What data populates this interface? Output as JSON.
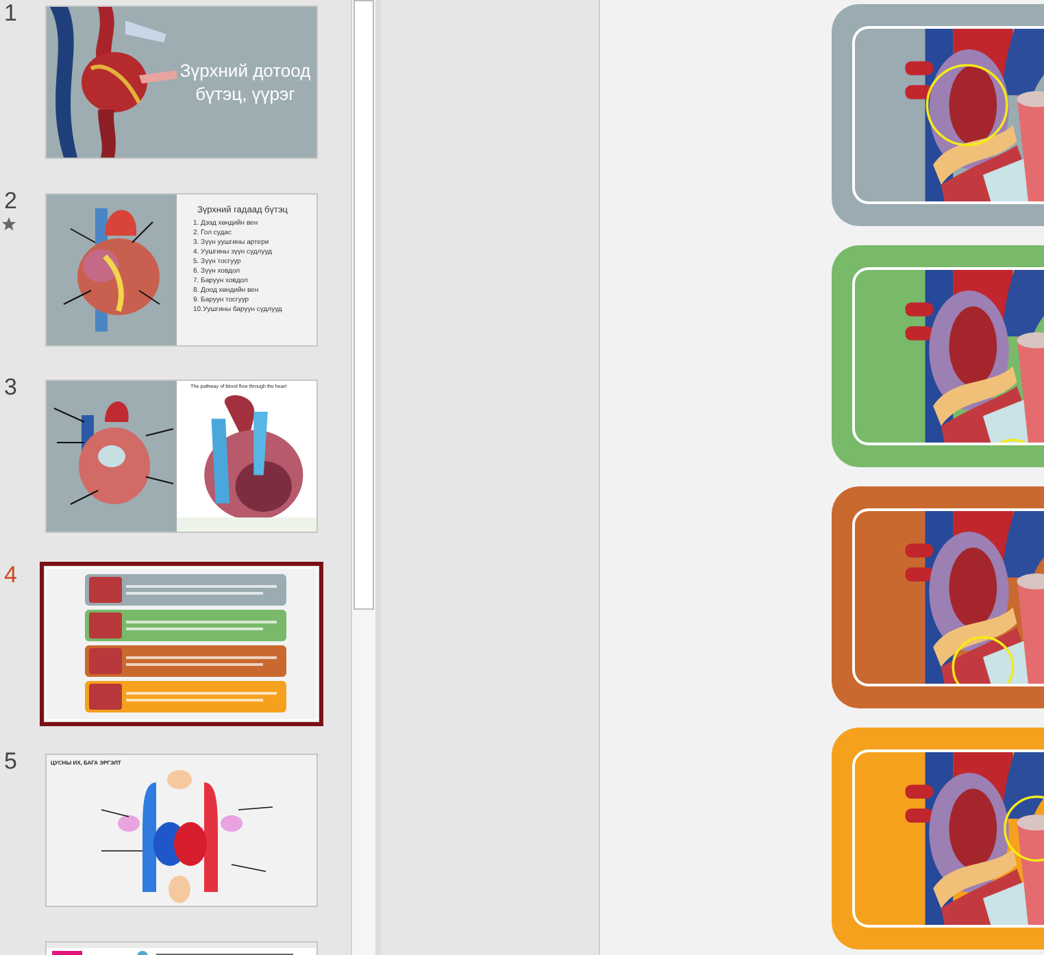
{
  "slides_panel": {
    "slides": [
      {
        "number": "1",
        "selected": false,
        "animated": false,
        "kind": "title",
        "title": "Зүрхний дотоод бүтэц, үүрэг"
      },
      {
        "number": "2",
        "selected": false,
        "animated": true,
        "kind": "list",
        "title": "Зүрхний гадаад бүтэц",
        "items": [
          "1. Дээд хөндийн вен",
          "2. Гол судас",
          "3. Зүүн уушгины артери",
          "4. Уушгины зүүн судлууд",
          "5. Зүүн тосгуур",
          "6. Зүүн ховдол",
          "7. Баруун ховдол",
          "8. Доод хөндийн вен",
          "9. Баруун тосгуур",
          "10.Уушгины баруун судлууд"
        ]
      },
      {
        "number": "3",
        "selected": false,
        "animated": false,
        "kind": "diagram",
        "title": "The pathway of blood flow through the heart"
      },
      {
        "number": "4",
        "selected": true,
        "animated": false,
        "kind": "cards"
      },
      {
        "number": "5",
        "selected": false,
        "animated": false,
        "kind": "circulation",
        "title": "ЦУСНЫ ИХ, БАГА ЭРГЭЛТ"
      },
      {
        "selected": false,
        "animated": false,
        "kind": "webpage"
      }
    ]
  },
  "slide": {
    "cards": [
      {
        "color": "#9aabb1"
      },
      {
        "color": "#79b96a"
      },
      {
        "color": "#c9692f"
      },
      {
        "color": "#f5a11e"
      }
    ]
  }
}
